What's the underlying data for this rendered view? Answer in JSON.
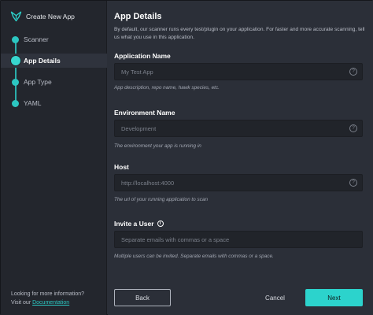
{
  "sidebar": {
    "brand_label": "Create New App",
    "steps": [
      {
        "label": "Scanner"
      },
      {
        "label": "App Details"
      },
      {
        "label": "App Type"
      },
      {
        "label": "YAML"
      }
    ],
    "help_text": "Looking for more information?",
    "visit_prefix": "Visit our ",
    "docs_link": "Documentation"
  },
  "main": {
    "title": "App Details",
    "description": "By default, our scanner runs every test/plugin on your application. For faster and more accurate scanning, tell us what you use in this application.",
    "fields": {
      "app_name": {
        "label": "Application Name",
        "placeholder": "My Test App",
        "hint": "App description, repo name, hawk species, etc."
      },
      "env_name": {
        "label": "Environment Name",
        "placeholder": "Development",
        "hint": "The environment your app is running in"
      },
      "host": {
        "label": "Host",
        "placeholder": "http://localhost:4000",
        "hint": "The url of your running application to scan"
      },
      "invite": {
        "label": "Invite a User",
        "placeholder": "Separate emails with commas or a space",
        "hint": "Multiple users can be invited. Separate emails with commas or a space."
      }
    },
    "buttons": {
      "back": "Back",
      "cancel": "Cancel",
      "next": "Next"
    }
  },
  "colors": {
    "accent": "#2cd3cc",
    "background": "#2b2f38",
    "sidebar": "#23262d",
    "input": "#21242a"
  },
  "icons": {
    "brand": "hawk-logo-icon",
    "info": "info-circle-icon",
    "help": "question-circle-icon"
  }
}
